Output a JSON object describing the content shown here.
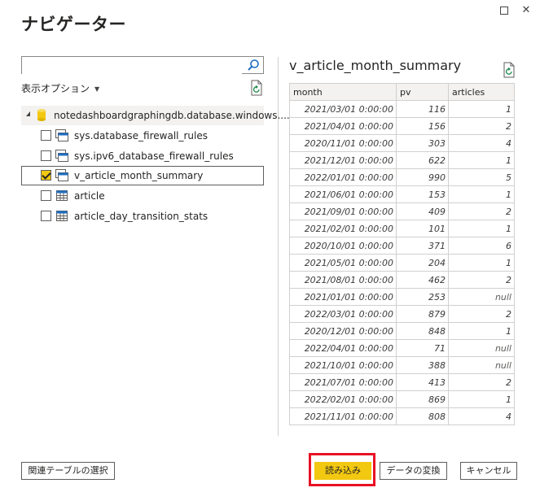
{
  "window": {
    "title": "ナビゲーター"
  },
  "search": {
    "value": "",
    "placeholder": ""
  },
  "options": {
    "label": "表示オプション"
  },
  "tree": {
    "database": {
      "label": "notedashboardgraphingdb.database.windows...."
    },
    "items": [
      {
        "label": "sys.database_firewall_rules",
        "checked": false,
        "type": "view"
      },
      {
        "label": "sys.ipv6_database_firewall_rules",
        "checked": false,
        "type": "view"
      },
      {
        "label": "v_article_month_summary",
        "checked": true,
        "type": "view"
      },
      {
        "label": "article",
        "checked": false,
        "type": "table"
      },
      {
        "label": "article_day_transition_stats",
        "checked": false,
        "type": "table"
      }
    ]
  },
  "preview": {
    "title": "v_article_month_summary",
    "columns": [
      "month",
      "pv",
      "articles"
    ],
    "rows": [
      [
        "2021/03/01 0:00:00",
        "116",
        "1"
      ],
      [
        "2021/04/01 0:00:00",
        "156",
        "2"
      ],
      [
        "2020/11/01 0:00:00",
        "303",
        "4"
      ],
      [
        "2021/12/01 0:00:00",
        "622",
        "1"
      ],
      [
        "2022/01/01 0:00:00",
        "990",
        "5"
      ],
      [
        "2021/06/01 0:00:00",
        "153",
        "1"
      ],
      [
        "2021/09/01 0:00:00",
        "409",
        "2"
      ],
      [
        "2021/02/01 0:00:00",
        "101",
        "1"
      ],
      [
        "2020/10/01 0:00:00",
        "371",
        "6"
      ],
      [
        "2021/05/01 0:00:00",
        "204",
        "1"
      ],
      [
        "2021/08/01 0:00:00",
        "462",
        "2"
      ],
      [
        "2021/01/01 0:00:00",
        "253",
        "null"
      ],
      [
        "2022/03/01 0:00:00",
        "879",
        "2"
      ],
      [
        "2020/12/01 0:00:00",
        "848",
        "1"
      ],
      [
        "2022/04/01 0:00:00",
        "71",
        "null"
      ],
      [
        "2021/10/01 0:00:00",
        "388",
        "null"
      ],
      [
        "2021/07/01 0:00:00",
        "413",
        "2"
      ],
      [
        "2022/02/01 0:00:00",
        "869",
        "1"
      ],
      [
        "2021/11/01 0:00:00",
        "808",
        "4"
      ]
    ]
  },
  "footer": {
    "related_label": "関連テーブルの選択",
    "load_label": "読み込み",
    "transform_label": "データの変換",
    "cancel_label": "キャンセル"
  },
  "colors": {
    "accent": "#f2c811",
    "highlight": "#e81123",
    "header_bg": "#f3f2f1"
  }
}
